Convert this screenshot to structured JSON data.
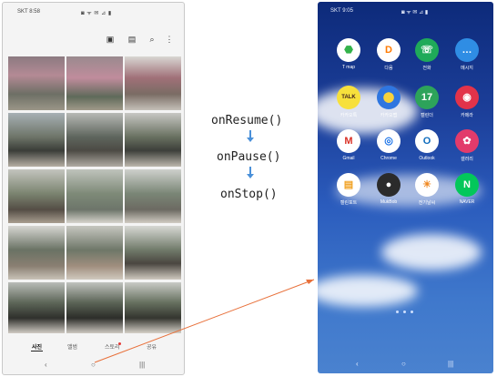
{
  "left_phone": {
    "status": {
      "carrier": "SKT 8:58",
      "icons": "◙ ᯤ ✉ ⊿ ▮"
    },
    "toolbar_icons": [
      "crop-icon",
      "check-icon",
      "search-icon",
      "more-icon"
    ],
    "tabs": [
      "사진",
      "앨범",
      "스토리",
      "공유"
    ],
    "active_tab": 0,
    "nav": [
      "‹",
      "○",
      "|||"
    ]
  },
  "middle": {
    "step1": "onResume()",
    "step2": "onPause()",
    "step3": "onStop()"
  },
  "right_phone": {
    "status": {
      "carrier": "SKT 9:05",
      "icons": "◙ ᯤ ✉ ⊿ ▮"
    },
    "apps": [
      {
        "label": "T map",
        "color": "#ffffff",
        "glyph_color": "#33b24a",
        "glyph": "⬣"
      },
      {
        "label": "다음",
        "color": "#ffffff",
        "glyph_color": "#ff7a00",
        "glyph": "D"
      },
      {
        "label": "전화",
        "color": "#1faa59",
        "glyph_color": "#ffffff",
        "glyph": "☏"
      },
      {
        "label": "메시지",
        "color": "#2f8de4",
        "glyph_color": "#ffffff",
        "glyph": "…"
      },
      {
        "label": "카카오톡",
        "color": "#f7e03c",
        "glyph_color": "#3c1e1e",
        "glyph": "TALK"
      },
      {
        "label": "카카오맵",
        "color": "#2f76e0",
        "glyph_color": "#f7d23c",
        "glyph": "⬤"
      },
      {
        "label": "캘린더",
        "color": "#2da35a",
        "glyph_color": "#ffffff",
        "glyph": "17"
      },
      {
        "label": "카메라",
        "color": "#e2334a",
        "glyph_color": "#ffffff",
        "glyph": "◉"
      },
      {
        "label": "Gmail",
        "color": "#ffffff",
        "glyph_color": "#d93025",
        "glyph": "M"
      },
      {
        "label": "Chrome",
        "color": "#ffffff",
        "glyph_color": "#1a73e8",
        "glyph": "◎"
      },
      {
        "label": "Outlook",
        "color": "#ffffff",
        "glyph_color": "#0f6cbd",
        "glyph": "O"
      },
      {
        "label": "갤러리",
        "color": "#e23b6b",
        "glyph_color": "#ffffff",
        "glyph": "✿"
      },
      {
        "label": "캘린포트",
        "color": "#ffffff",
        "glyph_color": "#f0a020",
        "glyph": "▤"
      },
      {
        "label": "MukBob",
        "color": "#2b2b2b",
        "glyph_color": "#ffffff",
        "glyph": "●"
      },
      {
        "label": "전기날씨",
        "color": "#ffffff",
        "glyph_color": "#f08a24",
        "glyph": "☀"
      },
      {
        "label": "NAVER",
        "color": "#03c75a",
        "glyph_color": "#ffffff",
        "glyph": "N"
      }
    ],
    "nav": [
      "‹",
      "○",
      "|||"
    ]
  }
}
